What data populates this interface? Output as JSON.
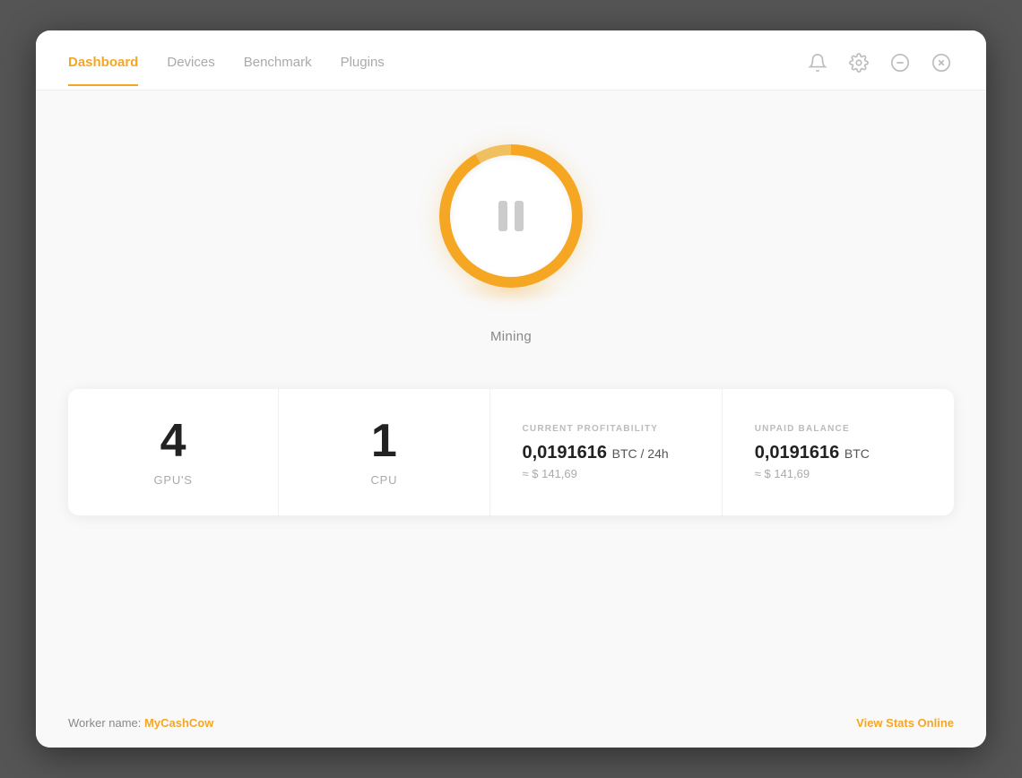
{
  "nav": {
    "tabs": [
      {
        "label": "Dashboard",
        "active": true
      },
      {
        "label": "Devices",
        "active": false
      },
      {
        "label": "Benchmark",
        "active": false
      },
      {
        "label": "Plugins",
        "active": false
      }
    ]
  },
  "icons": {
    "bell": "bell-icon",
    "gear": "gear-icon",
    "minus": "minus-icon",
    "close": "close-icon"
  },
  "mining": {
    "status_label": "Mining"
  },
  "stats": {
    "gpu_count": "4",
    "gpu_label": "GPU'S",
    "cpu_count": "1",
    "cpu_label": "CPU",
    "profitability_section_label": "CURRENT PROFITABILITY",
    "profitability_value": "0,0191616",
    "profitability_unit": "BTC / 24h",
    "profitability_approx": "≈ $ 141,69",
    "unpaid_section_label": "UNPAID BALANCE",
    "unpaid_value": "0,0191616",
    "unpaid_unit": "BTC",
    "unpaid_approx": "≈ $ 141,69"
  },
  "footer": {
    "worker_prefix": "Worker name:",
    "worker_name": "MyCashCow",
    "view_stats_label": "View Stats Online"
  }
}
